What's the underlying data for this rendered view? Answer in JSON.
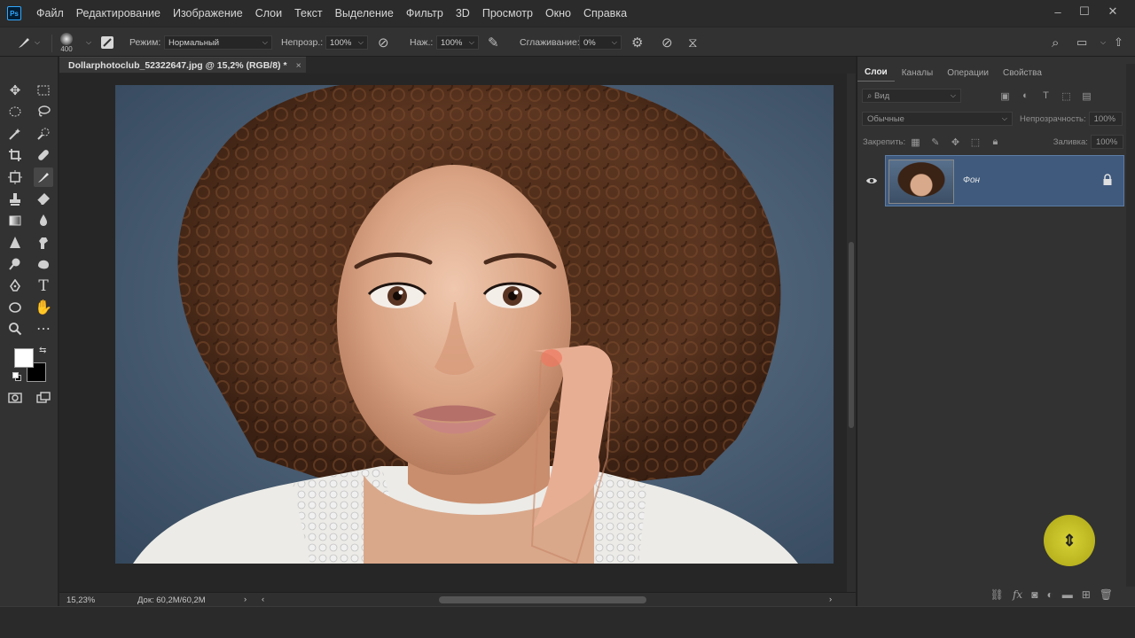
{
  "app": {
    "logo_text": "Ps"
  },
  "menubar": {
    "items": [
      "Файл",
      "Редактирование",
      "Изображение",
      "Слои",
      "Текст",
      "Выделение",
      "Фильтр",
      "3D",
      "Просмотр",
      "Окно",
      "Справка"
    ],
    "window_controls": [
      "–",
      "☐",
      "✕"
    ]
  },
  "options_bar": {
    "brush_size": "400",
    "mode_label": "Режим:",
    "mode_value": "Нормальный",
    "opacity_label": "Непрозр.:",
    "opacity_value": "100%",
    "pressure_label": "Наж.:",
    "pressure_value": "100%",
    "smoothing_label": "Сглаживание:",
    "smoothing_value": "0%"
  },
  "document": {
    "tab_title": "Dollarphotoclub_52322647.jpg @ 15,2% (RGB/8) *",
    "close_glyph": "×",
    "zoom": "15,23%",
    "doc_size": "Док: 60,2M/60,2M",
    "status_arrow": "›",
    "scroll_left": "‹",
    "scroll_right": "›"
  },
  "layers_panel": {
    "tabs": [
      "Слои",
      "Каналы",
      "Операции",
      "Свойства"
    ],
    "filter_placeholder": "Вид",
    "blend_mode": "Обычные",
    "opacity_label": "Непрозрачность:",
    "opacity_value": "100%",
    "lock_label": "Закрепить:",
    "fill_label": "Заливка:",
    "fill_value": "100%",
    "layers": [
      {
        "name": "Фон",
        "visible": true,
        "locked": true
      }
    ],
    "bottom_icons": [
      "link-icon",
      "fx-icon",
      "mask-icon",
      "adjustment-icon",
      "folder-icon",
      "new-layer-icon",
      "trash-icon"
    ]
  },
  "colors": {
    "foreground": "#ffffff",
    "background": "#000000",
    "accent_selected_layer": "#3f5a7d",
    "cursor_highlight": "#c9c326"
  },
  "cursor": {
    "glyph": "⇕"
  }
}
